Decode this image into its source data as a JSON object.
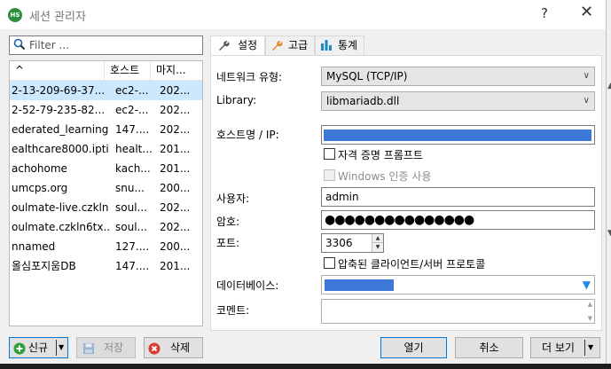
{
  "window": {
    "title": "세션 관리자",
    "app_icon_text": "HS",
    "help_label": "?",
    "close_label": "✕"
  },
  "filter": {
    "placeholder": "Filter ..."
  },
  "session_list": {
    "columns": [
      "^",
      "호스트",
      "마지..."
    ],
    "rows": [
      {
        "name": "2-13-209-69-37...",
        "host": "ec2-...",
        "last": "202...",
        "selected": true
      },
      {
        "name": "2-52-79-235-82...",
        "host": "ec2-...",
        "last": "202..."
      },
      {
        "name": "ederated_learning",
        "host": "147....",
        "last": "202..."
      },
      {
        "name": "ealthcare8000.ipti...",
        "host": "healt...",
        "last": "201..."
      },
      {
        "name": "achohome",
        "host": "kach...",
        "last": "201..."
      },
      {
        "name": "umcps.org",
        "host": "snu...",
        "last": "200..."
      },
      {
        "name": "oulmate-live.czkln...",
        "host": "soul...",
        "last": "202..."
      },
      {
        "name": "oulmate.czkln6tx...",
        "host": "soul...",
        "last": "202..."
      },
      {
        "name": "nnamed",
        "host": "127....",
        "last": "200..."
      },
      {
        "name": "올심포지움DB",
        "host": "147....",
        "last": "201..."
      }
    ]
  },
  "left_buttons": {
    "new_label": "신규",
    "save_label": "저장",
    "delete_label": "삭제"
  },
  "tabs": [
    {
      "label": "설정",
      "active": true
    },
    {
      "label": "고급"
    },
    {
      "label": "통계"
    }
  ],
  "settings": {
    "network_type_label": "네트워크 유형:",
    "network_type_value": "MySQL (TCP/IP)",
    "library_label": "Library:",
    "library_value": "libmariadb.dll",
    "host_label": "호스트명 / IP:",
    "credential_prompt_label": "자격 증명 프롬프트",
    "windows_auth_label": "Windows 인증 사용",
    "user_label": "사용자:",
    "user_value": "admin",
    "password_label": "암호:",
    "password_value": "●●●●●●●●●●●●●●●",
    "port_label": "포트:",
    "port_value": "3306",
    "compressed_label": "압축된 클라이언트/서버 프로토콜",
    "database_label": "데이터베이스:",
    "comment_label": "코멘트:"
  },
  "footer": {
    "open_label": "열기",
    "cancel_label": "취소",
    "more_label": "더 보기"
  },
  "colors": {
    "accent": "#0078d7",
    "redaction": "#3d78d8",
    "selection": "#cce8ff"
  }
}
